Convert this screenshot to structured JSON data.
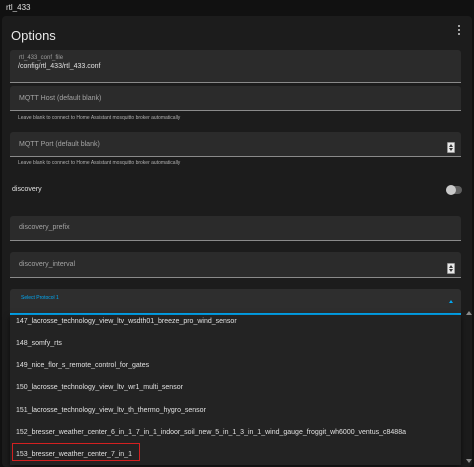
{
  "window": {
    "title": "rtl_433"
  },
  "card": {
    "title": "Options"
  },
  "fields": {
    "conf_file": {
      "label": "rtl_433_conf_file",
      "value": "/config/rtl_433/rtl_433.conf"
    },
    "mqtt_host": {
      "placeholder": "MQTT Host (default blank)",
      "helper": "Leave blank to connect to Home Assistant mosquitto broker automatically"
    },
    "mqtt_port": {
      "placeholder": "MQTT Port (default blank)",
      "helper": "Leave blank to connect to Home Assistant mosquitto broker automatically"
    },
    "discovery": {
      "label": "discovery",
      "enabled": false
    },
    "discovery_prefix": {
      "placeholder": "discovery_prefix"
    },
    "discovery_interval": {
      "placeholder": "discovery_interval"
    },
    "protocol": {
      "label": "Select Protocol 1"
    }
  },
  "dropdown": {
    "items": [
      "147_lacrosse_technology_view_ltv_wsdth01_breeze_pro_wind_sensor",
      "148_somfy_rts",
      "149_nice_flor_s_remote_control_for_gates",
      "150_lacrosse_technology_view_ltv_wr1_multi_sensor",
      "151_lacrosse_technology_view_ltv_th_thermo_hygro_sensor",
      "152_bresser_weather_center_6_in_1_7_in_1_indoor_soil_new_5_in_1_3_in_1_wind_gauge_froggit_wh6000_ventus_c8488a",
      "153_bresser_weather_center_7_in_1"
    ],
    "highlighted": "153_bresser_weather_center_7_in_1"
  },
  "colors": {
    "accent": "#03a9f4",
    "highlight_border": "#d32020",
    "background": "#111111",
    "card": "#1c1c1c"
  }
}
